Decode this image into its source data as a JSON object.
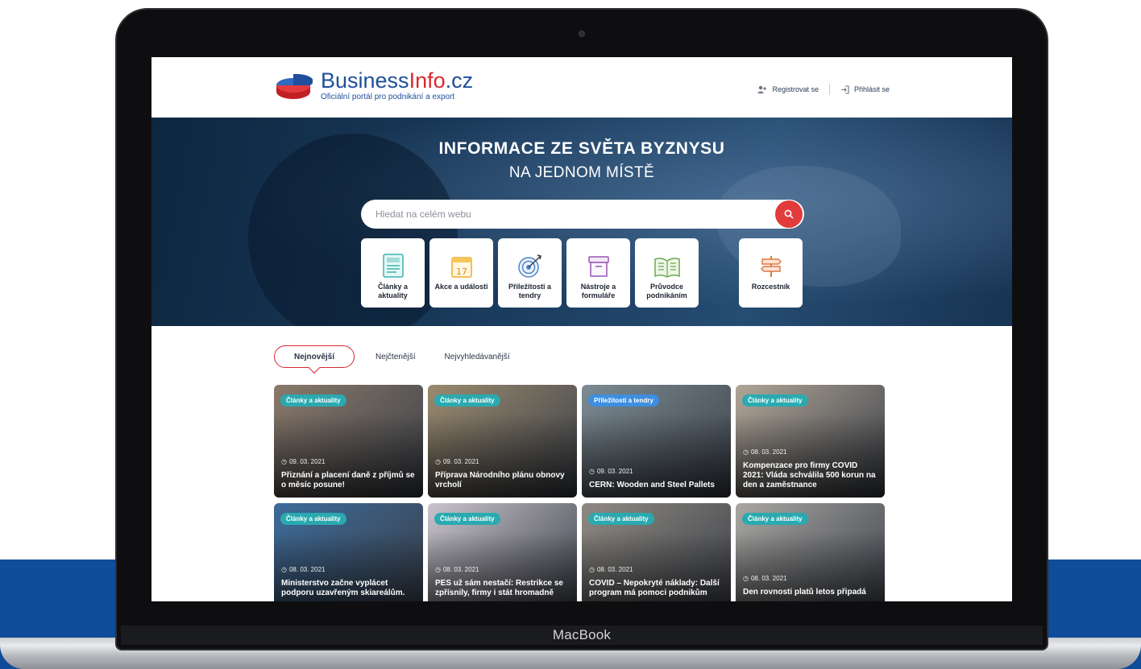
{
  "device": {
    "label": "MacBook"
  },
  "header": {
    "logo_name_blue": "Business",
    "logo_name_red": "Info",
    "logo_name_tld": ".cz",
    "logo_tagline": "Oficiální portál pro podnikání a export",
    "register_label": "Registrovat se",
    "login_label": "Přihlásit se"
  },
  "hero": {
    "title": "INFORMACE ZE SVĚTA BYZNYSU",
    "subtitle": "NA JEDNOM MÍSTĚ",
    "search_placeholder": "Hledat na celém webu"
  },
  "categories": [
    {
      "label": "Články a aktuality",
      "icon": "newspaper-icon"
    },
    {
      "label": "Akce a události",
      "icon": "calendar-icon"
    },
    {
      "label": "Příležitosti a tendry",
      "icon": "target-icon"
    },
    {
      "label": "Nástroje a formuláře",
      "icon": "archive-box-icon"
    },
    {
      "label": "Průvodce podnikáním",
      "icon": "book-icon"
    },
    {
      "label": "Rozcestník",
      "icon": "signpost-icon"
    }
  ],
  "tabs": [
    {
      "label": "Nejnovější",
      "active": true
    },
    {
      "label": "Nejčtenější",
      "active": false
    },
    {
      "label": "Nejvyhledávanější",
      "active": false
    }
  ],
  "articles": [
    {
      "badge": "Články a aktuality",
      "date": "09. 03. 2021",
      "title": "Přiznání a placení daně z příjmů se o měsíc posune!",
      "bg": "#8a7a6a"
    },
    {
      "badge": "Články a aktuality",
      "date": "09. 03. 2021",
      "title": "Příprava Národního plánu obnovy vrcholí",
      "bg": "#9a8a6e"
    },
    {
      "badge": "Příležitosti a tendry",
      "date": "09. 03. 2021",
      "title": "CERN: Wooden and Steel Pallets",
      "bg": "#7d8b93"
    },
    {
      "badge": "Články a aktuality",
      "date": "08. 03. 2021",
      "title": "Kompenzace pro firmy COVID 2021: Vláda schválila 500 korun na den a zaměstnance",
      "bg": "#b0a596"
    },
    {
      "badge": "Články a aktuality",
      "date": "08. 03. 2021",
      "title": "Ministerstvo začne vyplácet podporu uzavřeným skiareálům.",
      "bg": "#3d6b9a"
    },
    {
      "badge": "Články a aktuality",
      "date": "08. 03. 2021",
      "title": "PES už sám nestačí: Restrikce se zpřísnily, firmy i stát hromadně",
      "bg": "#c9c4cc"
    },
    {
      "badge": "Články a aktuality",
      "date": "08. 03. 2021",
      "title": "COVID – Nepokryté náklady: Další program má pomoci podnikům",
      "bg": "#8f8a82"
    },
    {
      "badge": "Články a aktuality",
      "date": "08. 03. 2021",
      "title": "Den rovnosti platů letos připadá",
      "bg": "#a9a7a3"
    }
  ]
}
